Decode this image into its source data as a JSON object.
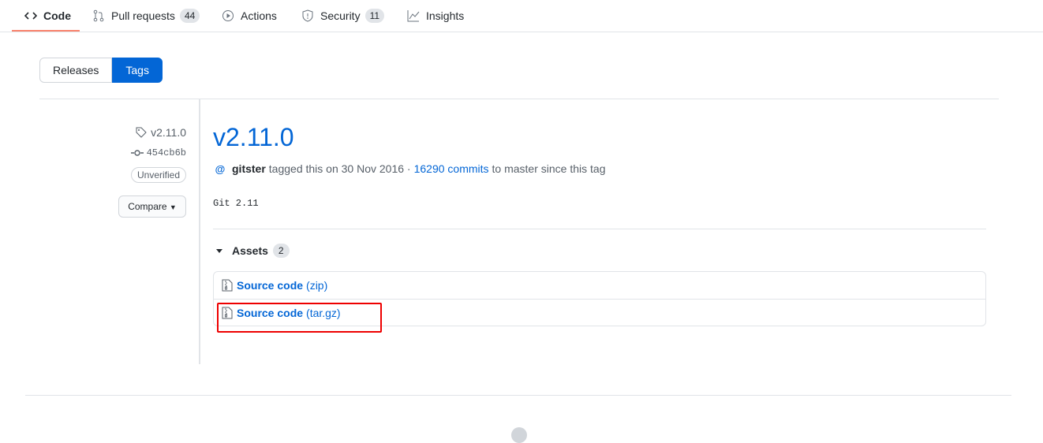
{
  "nav": {
    "tabs": [
      {
        "label": "Code",
        "icon": "code-icon",
        "count": null,
        "active": true
      },
      {
        "label": "Pull requests",
        "icon": "pull-request-icon",
        "count": "44"
      },
      {
        "label": "Actions",
        "icon": "play-icon",
        "count": null
      },
      {
        "label": "Security",
        "icon": "shield-icon",
        "count": "11"
      },
      {
        "label": "Insights",
        "icon": "graph-icon",
        "count": null
      }
    ]
  },
  "toggle": {
    "releases": "Releases",
    "tags": "Tags"
  },
  "release": {
    "tag": "v2.11.0",
    "commit": "454cb6b",
    "verification": "Unverified",
    "compare": "Compare",
    "title": "v2.11.0",
    "author": "gitster",
    "tagged_text": "tagged this on 30 Nov 2016 ·",
    "commits_link": "16290 commits",
    "since_text": "to master since this tag",
    "description": "Git 2.11"
  },
  "assets": {
    "label": "Assets",
    "count": "2",
    "items": [
      {
        "name": "Source code",
        "ext": "(zip)"
      },
      {
        "name": "Source code",
        "ext": "(tar.gz)"
      }
    ]
  },
  "colors": {
    "accent": "#0366d6",
    "highlight": "#e00000",
    "tab_underline": "#f9826c"
  }
}
